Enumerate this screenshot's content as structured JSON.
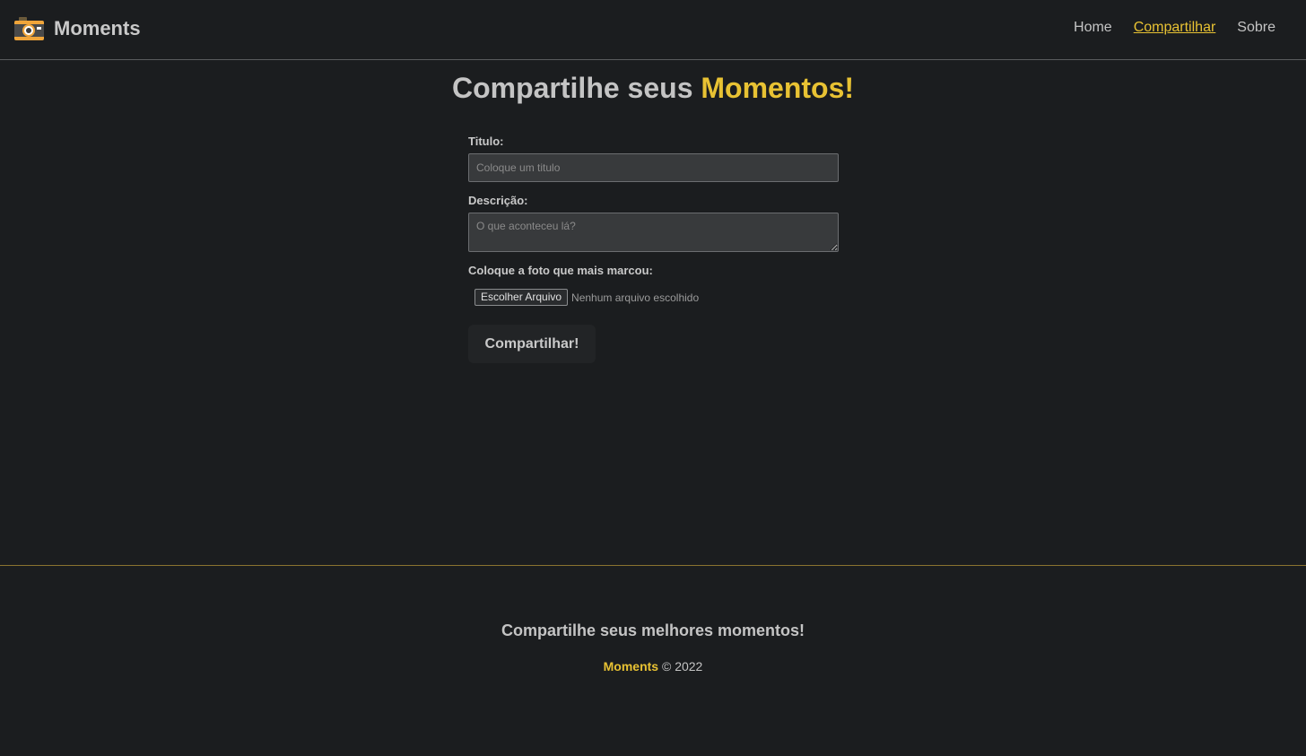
{
  "header": {
    "brand_name": "Moments",
    "logo_icon": "camera-icon",
    "nav": [
      {
        "label": "Home",
        "active": false
      },
      {
        "label": "Compartilhar",
        "active": true
      },
      {
        "label": "Sobre",
        "active": false
      }
    ]
  },
  "main": {
    "title_prefix": "Compartilhe seus ",
    "title_accent": "Momentos!",
    "form": {
      "titulo_label": "Titulo:",
      "titulo_placeholder": "Coloque um titulo",
      "titulo_value": "",
      "descricao_label": "Descrição:",
      "descricao_placeholder": "O que aconteceu lá?",
      "descricao_value": "",
      "foto_label": "Coloque a foto que mais marcou:",
      "file_button_label": "Escolher Arquivo",
      "file_status": "Nenhum arquivo escolhido",
      "submit_label": "Compartilhar!"
    }
  },
  "footer": {
    "tagline": "Compartilhe seus melhores momentos!",
    "copy_brand": "Moments",
    "copy_text": " © 2022"
  },
  "colors": {
    "background": "#1b1d1f",
    "accent": "#e8c233",
    "text": "#c4c4c4",
    "input_bg": "#383a3c"
  }
}
